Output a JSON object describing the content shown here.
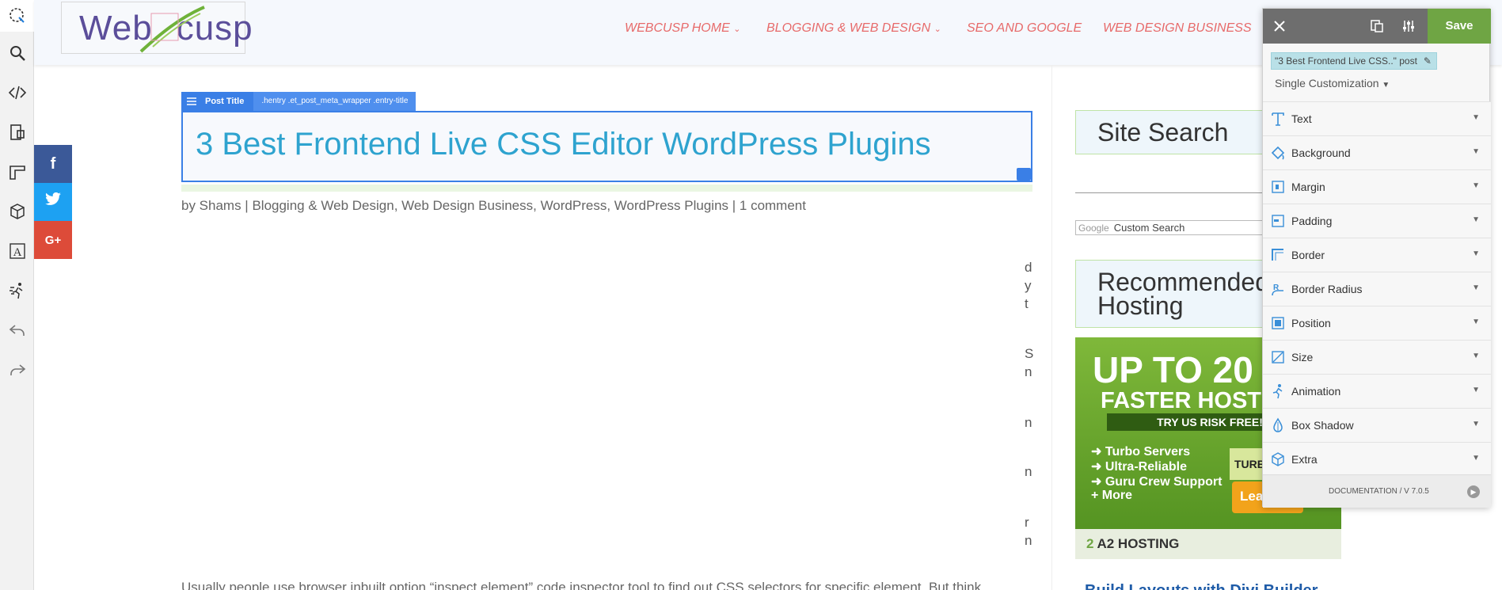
{
  "header": {
    "logo": {
      "part1": "Web",
      "part2": "cusp"
    },
    "nav": [
      {
        "label": "WEBCUSP HOME",
        "has_dropdown": true
      },
      {
        "label": "BLOGGING & WEB DESIGN",
        "has_dropdown": true
      },
      {
        "label": "SEO AND GOOGLE",
        "has_dropdown": false
      },
      {
        "label": "WEB DESIGN BUSINESS",
        "has_dropdown": false
      }
    ]
  },
  "left_toolbar": {
    "icons": [
      "selector-icon",
      "search-icon",
      "code-icon",
      "layout-icon",
      "ruler-icon",
      "cube-icon",
      "font-icon",
      "animation-icon",
      "undo-icon",
      "redo-icon"
    ]
  },
  "social": {
    "facebook": "f",
    "twitter": "t",
    "googleplus": "G+",
    "colors": {
      "facebook": "#3b5998",
      "twitter": "#1da1f2",
      "googleplus": "#dd4b39"
    }
  },
  "post": {
    "tag_label": "Post Title",
    "tag_selector": ".hentry .et_post_meta_wrapper .entry-title",
    "title": "3 Best Frontend Live CSS Editor WordPress Plugins",
    "meta": "by Shams | Blogging & Web Design, Web Design Business, WordPress, WordPress Plugins | 1 comment",
    "fragments": [
      "d",
      "y",
      "t",
      "S",
      "n",
      "n",
      "n",
      "r",
      "n"
    ],
    "bottom_text": "Usually people use browser inbuilt option “inspect element” code inspector tool to find out CSS selectors for specific element. But think"
  },
  "sidebar": {
    "site_search_title": "Site Search",
    "custom_search_brand": "Google",
    "custom_search_placeholder": "Custom Search",
    "recommended_title_1": "Recommended",
    "recommended_title_2": "Hosting",
    "ad": {
      "headline": "UP TO 20",
      "sub": "FASTER HOST",
      "try": "TRY US RISK FREE!",
      "bullets": [
        "Turbo Servers",
        "Ultra-Reliable",
        "Guru Crew Support",
        "+ More"
      ],
      "turbo": "TURBO",
      "learn": "Lea",
      "footer": "A2 HOSTING"
    },
    "next_title": "Build Layouts with Divi Builder"
  },
  "panel": {
    "save_label": "Save",
    "post_chip": "\"3 Best Frontend Live CSS..\" post",
    "customization": "Single Customization",
    "sections": [
      "Text",
      "Background",
      "Margin",
      "Padding",
      "Border",
      "Border Radius",
      "Position",
      "Size",
      "Animation",
      "Box Shadow",
      "Extra"
    ],
    "footer": "DOCUMENTATION / V 7.0.5"
  }
}
